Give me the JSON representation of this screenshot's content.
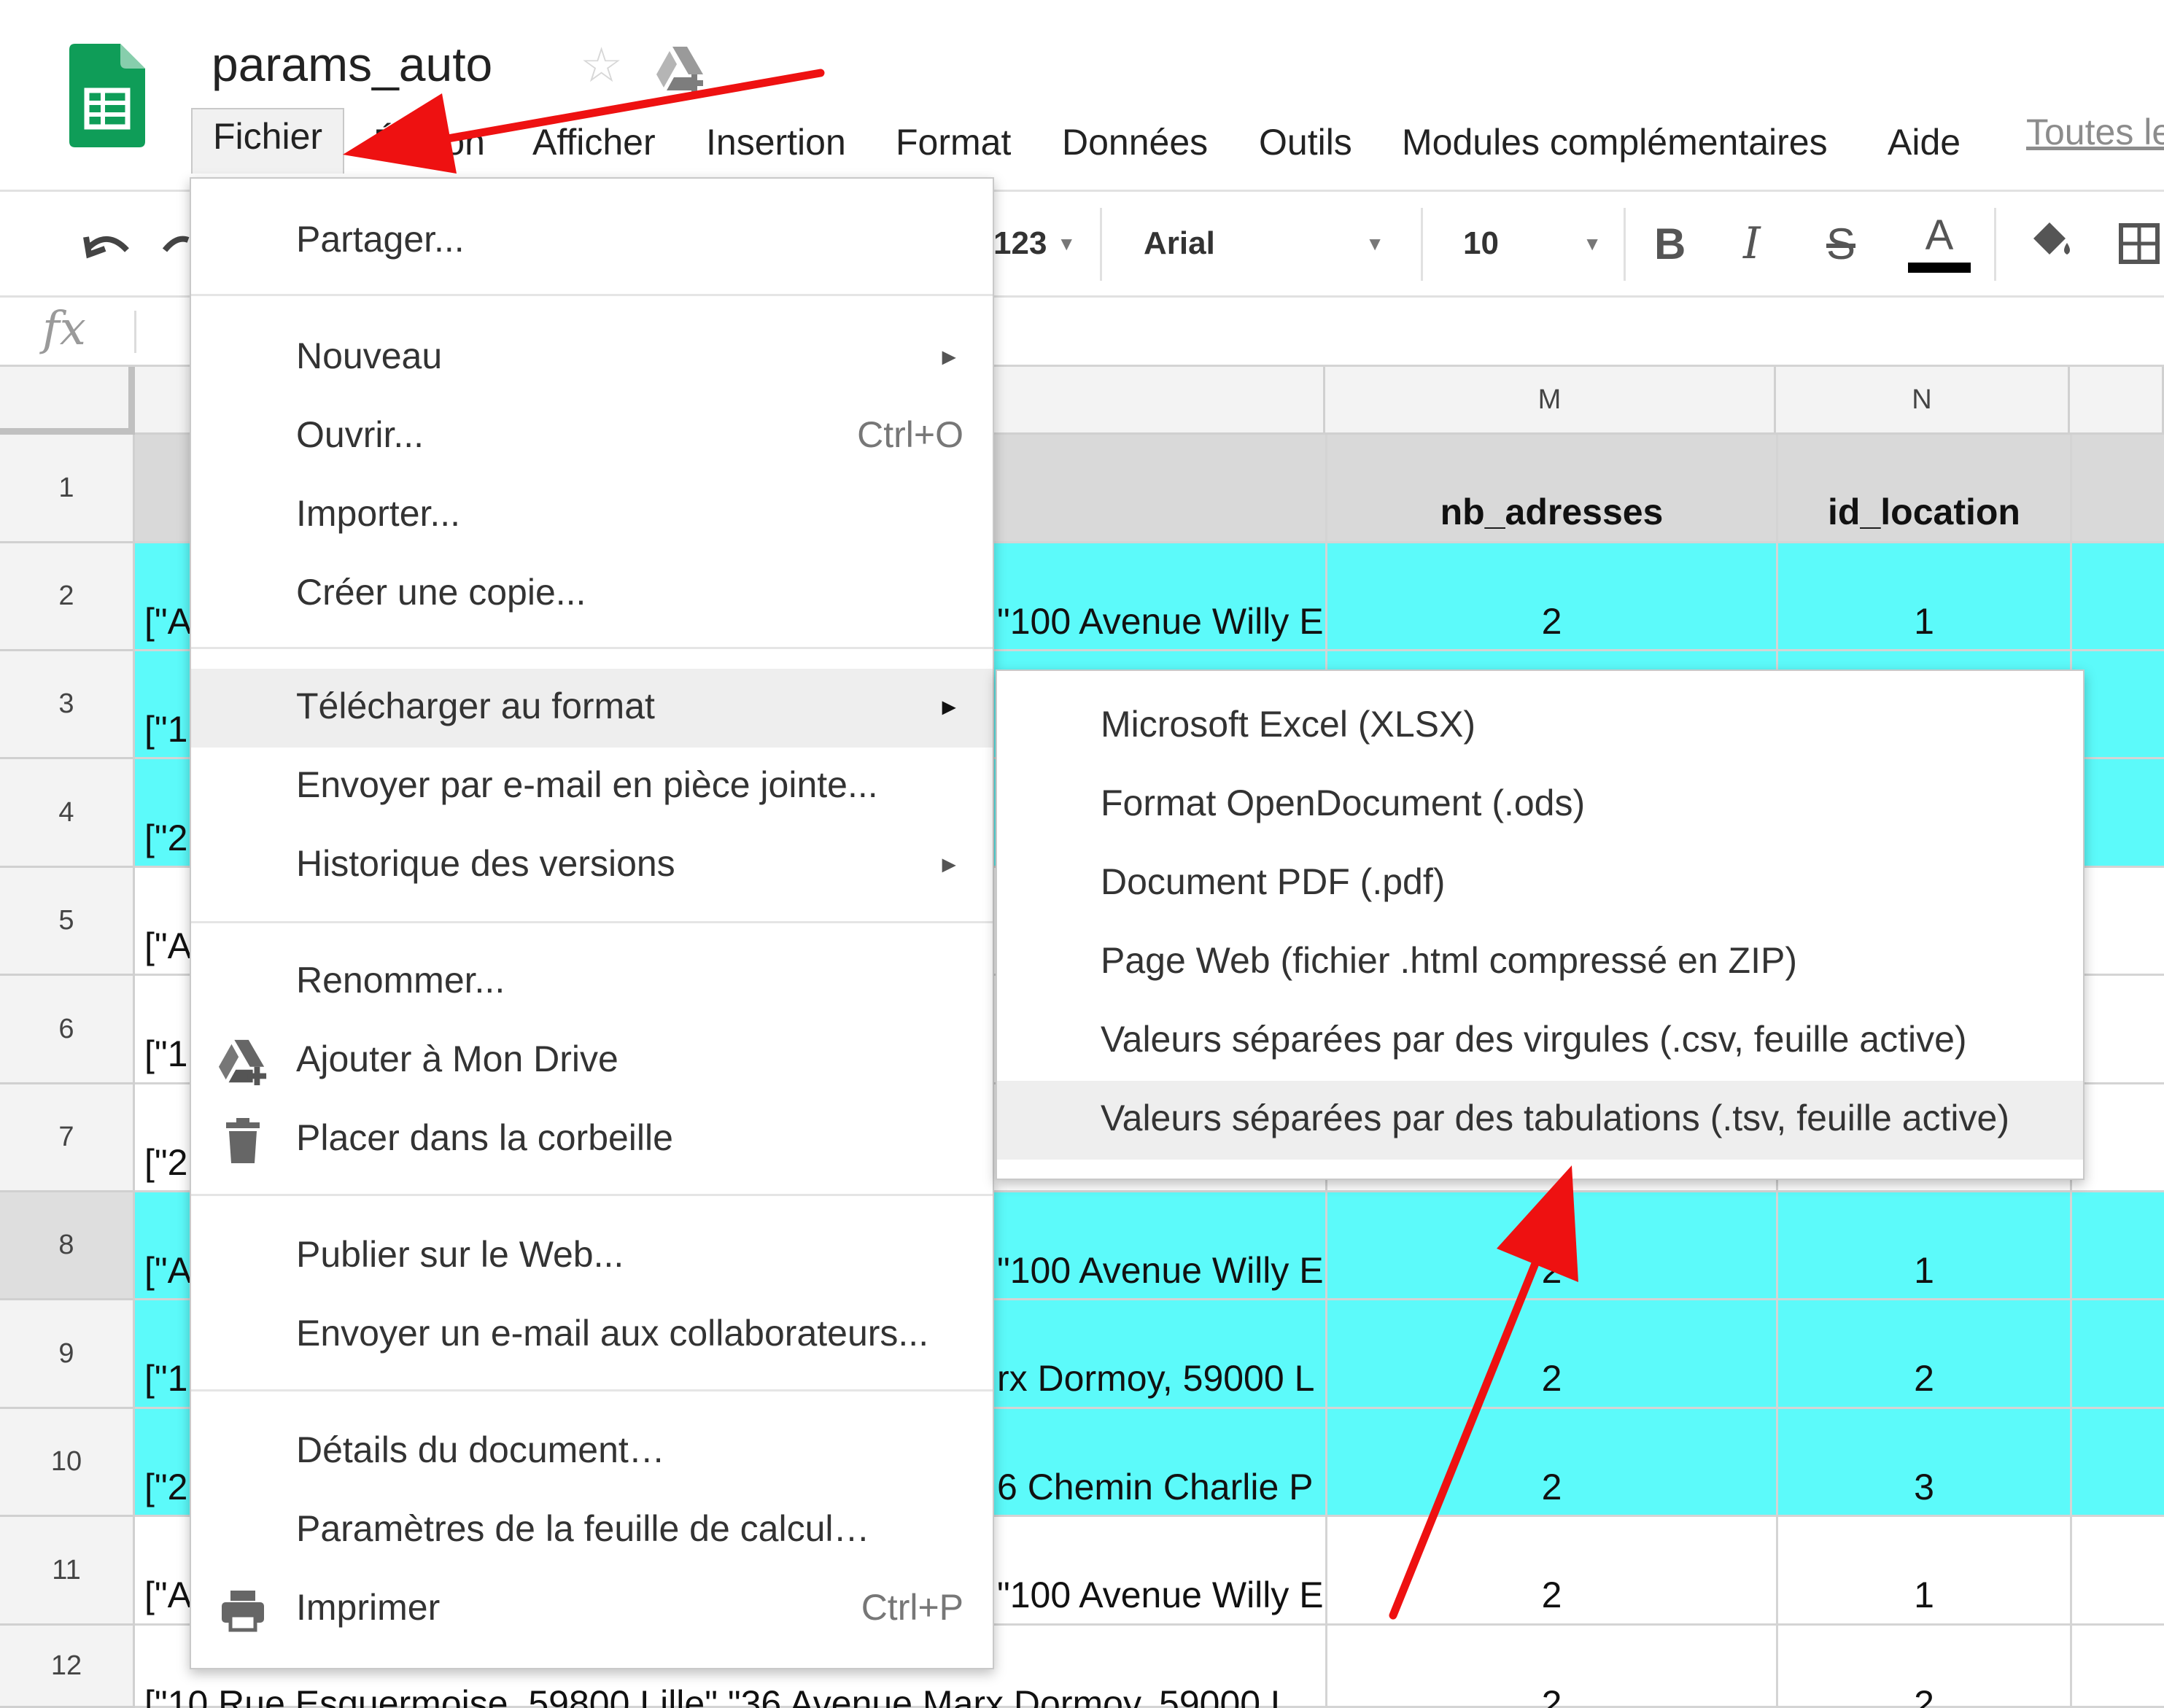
{
  "document": {
    "title": "params_auto"
  },
  "menubar": {
    "items": [
      "Fichier",
      "Édition",
      "Afficher",
      "Insertion",
      "Format",
      "Données",
      "Outils",
      "Modules complémentaires",
      "Aide"
    ],
    "last_edit_link": "Toutes le"
  },
  "toolbar": {
    "number_format": "123",
    "font": "Arial",
    "font_size": "10",
    "bold": "B",
    "italic": "I",
    "strike": "S",
    "text_color": "A"
  },
  "formula_bar": {
    "fx_label": "fx"
  },
  "grid": {
    "columns": [
      "M",
      "N"
    ],
    "headers": {
      "m": "nb_adresses",
      "n": "id_location"
    },
    "rows": [
      {
        "num": "1",
        "a": "",
        "l": "",
        "m": "nb_adresses",
        "n": "id_location"
      },
      {
        "num": "2",
        "a": "[\"A",
        "l": "\"100 Avenue Willy E",
        "m": "2",
        "n": "1"
      },
      {
        "num": "3",
        "a": "[\"1",
        "l": "",
        "m": "",
        "n": ""
      },
      {
        "num": "4",
        "a": "[\"2",
        "l": "",
        "m": "",
        "n": ""
      },
      {
        "num": "5",
        "a": "[\"A",
        "l": "",
        "m": "",
        "n": ""
      },
      {
        "num": "6",
        "a": "[\"1",
        "l": "",
        "m": "",
        "n": ""
      },
      {
        "num": "7",
        "a": "[\"2",
        "l": "",
        "m": "",
        "n": ""
      },
      {
        "num": "8",
        "a": "[\"A",
        "l": "\"100 Avenue Willy E",
        "m": "2",
        "n": "1"
      },
      {
        "num": "9",
        "a": "[\"1",
        "l": "rx Dormoy, 59000 L",
        "m": "2",
        "n": "2"
      },
      {
        "num": "10",
        "a": "[\"2",
        "l": "6 Chemin Charlie P",
        "m": "2",
        "n": "3"
      },
      {
        "num": "11",
        "a": "[\"A",
        "l": "\"100 Avenue Willy E",
        "m": "2",
        "n": "1"
      },
      {
        "num": "12",
        "a": "[\"10 Rue Esquermoise, 59800 Lille\",\"36 Avenue Marx Dormoy, 59000 L",
        "l": "",
        "m": "2",
        "n": "2"
      }
    ]
  },
  "file_menu": {
    "share": "Partager...",
    "new": "Nouveau",
    "open": "Ouvrir...",
    "open_shortcut": "Ctrl+O",
    "import": "Importer...",
    "copy": "Créer une copie...",
    "download": "Télécharger au format",
    "email_attachment": "Envoyer par e-mail en pièce jointe...",
    "version_history": "Historique des versions",
    "rename": "Renommer...",
    "add_to_drive": "Ajouter à Mon Drive",
    "trash": "Placer dans la corbeille",
    "publish": "Publier sur le Web...",
    "email_collaborators": "Envoyer un e-mail aux collaborateurs...",
    "doc_details": "Détails du document…",
    "spreadsheet_settings": "Paramètres de la feuille de calcul…",
    "print": "Imprimer",
    "print_shortcut": "Ctrl+P",
    "submenu_arrow": "►"
  },
  "download_submenu": {
    "xlsx": "Microsoft Excel (XLSX)",
    "ods": "Format OpenDocument (.ods)",
    "pdf": "Document PDF (.pdf)",
    "html": "Page Web (fichier .html compressé en ZIP)",
    "csv": "Valeurs séparées par des virgules (.csv, feuille active)",
    "tsv": "Valeurs séparées par des tabulations (.tsv, feuille active)"
  },
  "colors": {
    "highlight_row": "#5cfafa",
    "header_row": "#d9d9d9",
    "sheets_green": "#0f9d58",
    "annotation_arrow": "#ee1111"
  },
  "icons": [
    "sheets-logo-icon",
    "star-icon",
    "drive-add-icon",
    "undo-icon",
    "redo-icon",
    "fill-color-icon",
    "borders-icon",
    "drive-add-icon",
    "trash-icon",
    "print-icon"
  ]
}
